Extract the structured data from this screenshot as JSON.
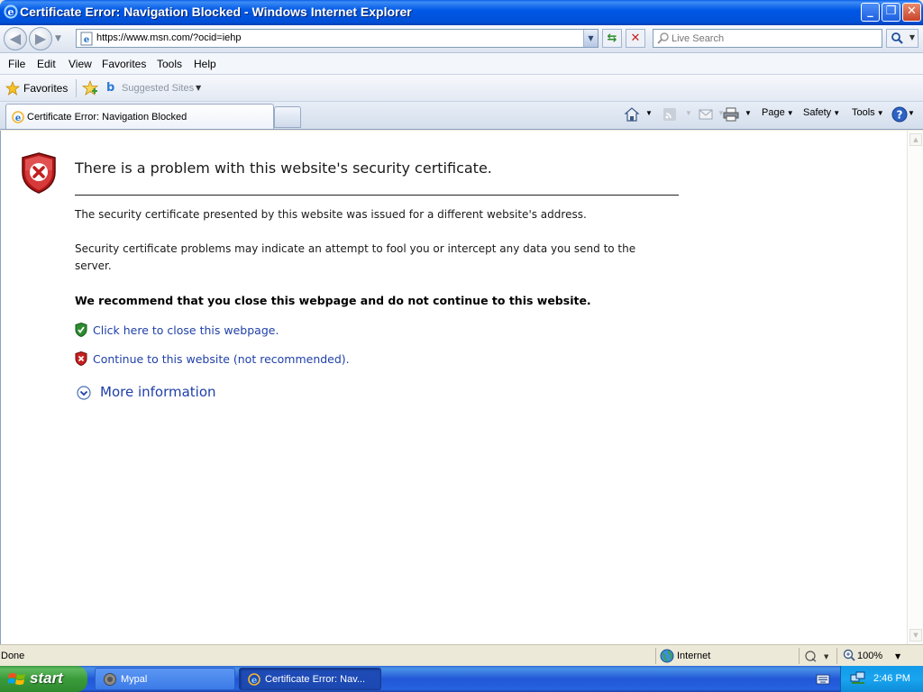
{
  "window": {
    "title": "Certificate Error: Navigation Blocked - Windows Internet Explorer",
    "buttons": {
      "minimize": "_",
      "maximize": "❐",
      "close": "✕"
    }
  },
  "address_bar": {
    "url": "https://www.msn.com/?ocid=iehp",
    "search_placeholder": "Live Search"
  },
  "menu": {
    "items": [
      "File",
      "Edit",
      "View",
      "Favorites",
      "Tools",
      "Help"
    ]
  },
  "favorites_bar": {
    "favorites_label": "Favorites",
    "suggested_sites_label": "Suggested Sites"
  },
  "tabs": {
    "active_title": "Certificate Error: Navigation Blocked"
  },
  "command_bar": {
    "page_label": "Page",
    "safety_label": "Safety",
    "tools_label": "Tools"
  },
  "content": {
    "heading": "There is a problem with this website's security certificate.",
    "para1": "The security certificate presented by this website was issued for a different website's address.",
    "para2": "Security certificate problems may indicate an attempt to fool you or intercept any data you send to the server.",
    "recommendation": "We recommend that you close this webpage and do not continue to this website.",
    "close_link": "Click here to close this webpage.",
    "continue_link": "Continue to this website (not recommended).",
    "more_info": "More information"
  },
  "status_bar": {
    "status": "Done",
    "zone": "Internet",
    "zoom": "100%"
  },
  "taskbar": {
    "start_label": "start",
    "items": [
      {
        "label": "Mypal"
      },
      {
        "label": "Certificate Error: Nav..."
      }
    ],
    "clock": "2:46 PM"
  },
  "colors": {
    "title_bar": "#0058E6",
    "link": "#1F3FA8",
    "start_button": "#3A9B3A",
    "taskbar": "#2157D7"
  }
}
